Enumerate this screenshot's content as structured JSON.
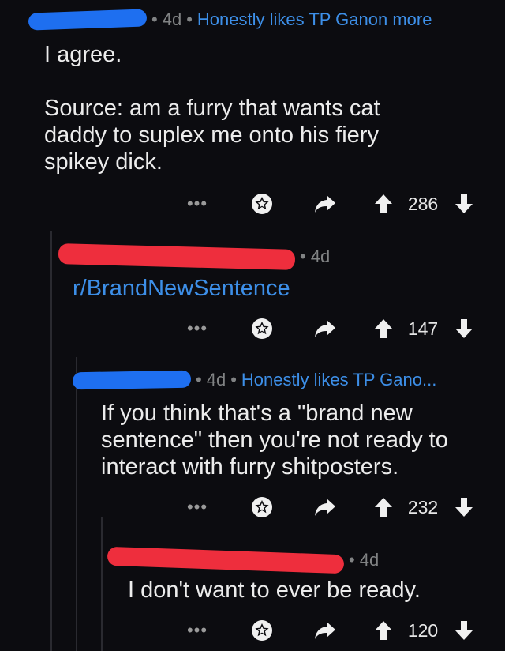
{
  "comments": [
    {
      "age": "4d",
      "flair": "Honestly likes TP Ganon more",
      "body": [
        "I agree.",
        "",
        "Source: am a furry that wants cat",
        "daddy to suplex me onto his fiery",
        "spikey dick."
      ],
      "score": "286"
    },
    {
      "age": "4d",
      "flair": "",
      "body": [
        "r/BrandNewSentence"
      ],
      "score": "147"
    },
    {
      "age": "4d",
      "flair": "Honestly likes TP Gano...",
      "body": [
        "If you think that's a \"brand new",
        "sentence\" then you're not ready to",
        "interact with furry shitposters."
      ],
      "score": "232"
    },
    {
      "age": "4d",
      "flair": "",
      "body": [
        "I don't want to ever be ready."
      ],
      "score": "120"
    }
  ],
  "actions": {
    "more": "•••",
    "icons": [
      "more-options-icon",
      "award-icon",
      "reply-icon",
      "upvote-icon",
      "downvote-icon"
    ]
  },
  "colors": {
    "background": "#0c0c10",
    "flair": "#3d8fe8",
    "meta": "#818384",
    "redaction_blue": "#1e6ff0",
    "redaction_red": "#ee2e3d"
  }
}
